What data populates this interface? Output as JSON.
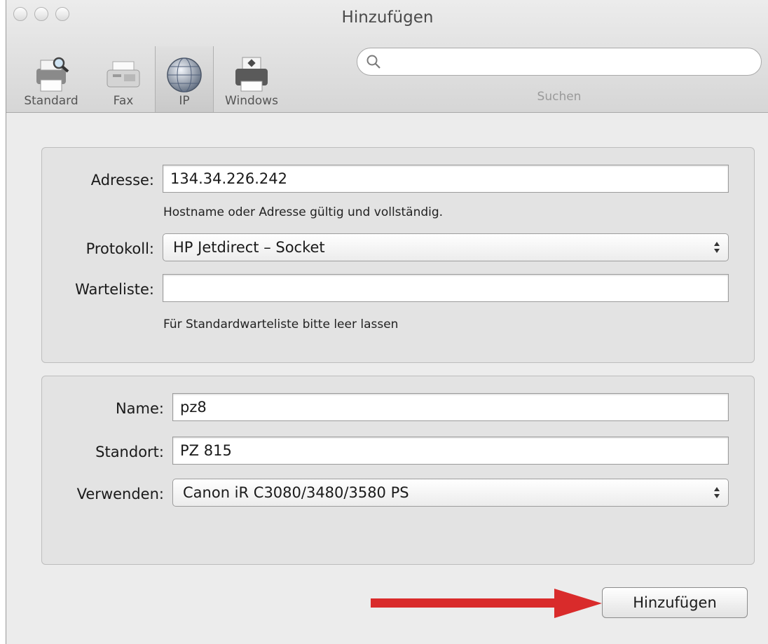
{
  "window": {
    "title": "Hinzufügen"
  },
  "toolbar": {
    "items": [
      {
        "label": "Standard",
        "icon": "printer-magnifier-icon"
      },
      {
        "label": "Fax",
        "icon": "fax-machine-icon"
      },
      {
        "label": "IP",
        "icon": "globe-icon",
        "selected": true
      },
      {
        "label": "Windows",
        "icon": "windows-printer-icon"
      }
    ],
    "search": {
      "label": "Suchen",
      "value": ""
    }
  },
  "connection": {
    "address_label": "Adresse:",
    "address_value": "134.34.226.242",
    "address_hint": "Hostname oder Adresse gültig und vollständig.",
    "protocol_label": "Protokoll:",
    "protocol_value": "HP Jetdirect – Socket",
    "queue_label": "Warteliste:",
    "queue_value": "",
    "queue_hint": "Für Standardwarteliste bitte leer lassen"
  },
  "printer": {
    "name_label": "Name:",
    "name_value": "pz8",
    "location_label": "Standort:",
    "location_value": "PZ 815",
    "use_label": "Verwenden:",
    "use_value": "Canon iR C3080/3480/3580 PS"
  },
  "actions": {
    "add_label": "Hinzufügen"
  },
  "colors": {
    "annotation_arrow": "#d92b2b"
  }
}
